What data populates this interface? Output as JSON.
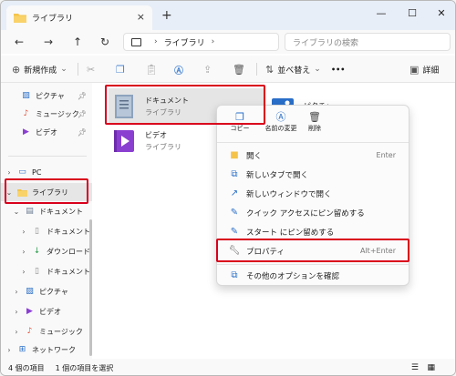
{
  "window": {
    "tab_title": "ライブラリ",
    "tab_close": "×",
    "new_tab": "+",
    "minimize": "—",
    "maximize": "☐",
    "close": "✕"
  },
  "address": {
    "back": "←",
    "forward": "→",
    "up": "↑",
    "refresh": "↻",
    "crumb_sep": "›",
    "path": "ライブラリ",
    "path_chevron": "›",
    "search_placeholder": "ライブラリの検索"
  },
  "toolbar": {
    "new_label": "新規作成",
    "new_chevron": "⌄",
    "sort_label": "並べ替え",
    "sort_chevron": "⌄",
    "more": "•••",
    "details_label": "詳細"
  },
  "sidebar": {
    "pinned": [
      {
        "label": "ピクチャ"
      },
      {
        "label": "ミュージック"
      },
      {
        "label": "ビデオ"
      }
    ],
    "pc": "PC",
    "libraries": "ライブラリ",
    "documents": "ドキュメント",
    "doc_children": [
      "ドキュメント",
      "ダウンロード",
      "ドキュメント"
    ],
    "pictures": "ピクチャ",
    "videos": "ビデオ",
    "music": "ミュージック",
    "network": "ネットワーク",
    "expanded": "⌄",
    "collapsed": "›"
  },
  "content": {
    "items": [
      {
        "name": "ドキュメント",
        "sub": "ライブラリ"
      },
      {
        "name": "ピクチャ",
        "sub": ""
      },
      {
        "name": "ビデオ",
        "sub": "ライブラリ"
      }
    ]
  },
  "status": {
    "count": "4 個の項目",
    "selected": "1 個の項目を選択"
  },
  "context_menu": {
    "quick": [
      {
        "label": "コピー"
      },
      {
        "label": "名前の変更"
      },
      {
        "label": "削除"
      }
    ],
    "items": [
      {
        "label": "開く",
        "shortcut": "Enter"
      },
      {
        "label": "新しいタブで開く",
        "shortcut": ""
      },
      {
        "label": "新しいウィンドウで開く",
        "shortcut": ""
      },
      {
        "label": "クイック アクセスにピン留めする",
        "shortcut": ""
      },
      {
        "label": "スタート にピン留めする",
        "shortcut": ""
      },
      {
        "label": "プロパティ",
        "shortcut": "Alt+Enter"
      },
      {
        "label": "その他のオプションを確認",
        "shortcut": ""
      }
    ]
  },
  "colors": {
    "highlight": "#d9001b",
    "accent": "#2a6fc9",
    "folder": "#f4c44a"
  }
}
